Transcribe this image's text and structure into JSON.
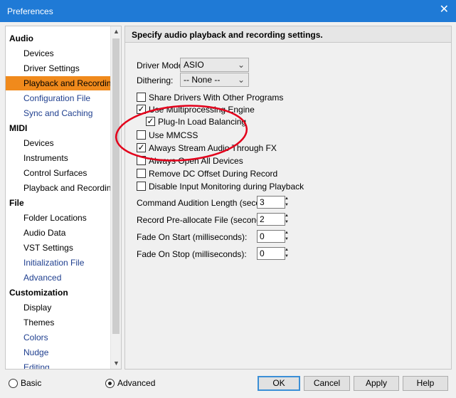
{
  "window": {
    "title": "Preferences",
    "close_glyph": "✕"
  },
  "nav": {
    "items": [
      {
        "label": "Audio",
        "kind": "group"
      },
      {
        "label": "Devices",
        "kind": "sub"
      },
      {
        "label": "Driver Settings",
        "kind": "sub"
      },
      {
        "label": "Playback and Recording",
        "kind": "sub",
        "selected": true
      },
      {
        "label": "Configuration File",
        "kind": "link"
      },
      {
        "label": "Sync and Caching",
        "kind": "link"
      },
      {
        "label": "MIDI",
        "kind": "group"
      },
      {
        "label": "Devices",
        "kind": "sub"
      },
      {
        "label": "Instruments",
        "kind": "sub"
      },
      {
        "label": "Control Surfaces",
        "kind": "sub"
      },
      {
        "label": "Playback and Recording",
        "kind": "sub"
      },
      {
        "label": "File",
        "kind": "group"
      },
      {
        "label": "Folder Locations",
        "kind": "sub"
      },
      {
        "label": "Audio Data",
        "kind": "sub"
      },
      {
        "label": "VST Settings",
        "kind": "sub"
      },
      {
        "label": "Initialization File",
        "kind": "link"
      },
      {
        "label": "Advanced",
        "kind": "link"
      },
      {
        "label": "Customization",
        "kind": "group"
      },
      {
        "label": "Display",
        "kind": "sub"
      },
      {
        "label": "Themes",
        "kind": "sub"
      },
      {
        "label": "Colors",
        "kind": "link"
      },
      {
        "label": "Nudge",
        "kind": "link"
      },
      {
        "label": "Editing",
        "kind": "link"
      }
    ],
    "scroll_up_glyph": "▲",
    "scroll_down_glyph": "▼"
  },
  "panel": {
    "header": "Specify audio playback and recording settings.",
    "driver_mode": {
      "label": "Driver Mode:",
      "value": "ASIO"
    },
    "dithering": {
      "label": "Dithering:",
      "value": "-- None --"
    },
    "combo_chevron": "⌄",
    "checkboxes": [
      {
        "label": "Share Drivers With Other Programs",
        "checked": false
      },
      {
        "label": "Use Multiprocessing Engine",
        "checked": true
      },
      {
        "label": "Plug-In Load Balancing",
        "checked": true
      },
      {
        "label": "Use MMCSS",
        "checked": false
      },
      {
        "label": "Always Stream Audio Through FX",
        "checked": true
      },
      {
        "label": "Always Open All Devices",
        "checked": false
      },
      {
        "label": "Remove DC Offset During Record",
        "checked": false
      },
      {
        "label": "Disable Input Monitoring during Playback",
        "checked": false
      }
    ],
    "check_glyph": "✓",
    "spinners": [
      {
        "label": "Command Audition Length (seconds):",
        "value": "3"
      },
      {
        "label": "Record Pre-allocate File (seconds):",
        "value": "2"
      },
      {
        "label": "Fade On Start  (milliseconds):",
        "value": "0"
      },
      {
        "label": "Fade On Stop  (milliseconds):",
        "value": "0"
      }
    ],
    "spin_up_glyph": "▲",
    "spin_down_glyph": "▼",
    "annotation_color": "#e3001b"
  },
  "footer": {
    "basic_label": "Basic",
    "advanced_label": "Advanced",
    "mode_selected": "Advanced",
    "ok_label": "OK",
    "cancel_label": "Cancel",
    "apply_label": "Apply",
    "help_label": "Help"
  },
  "colors": {
    "titlebar": "#1f7ad6",
    "selection": "#f08a1c",
    "link_text": "#1f3f8f"
  }
}
